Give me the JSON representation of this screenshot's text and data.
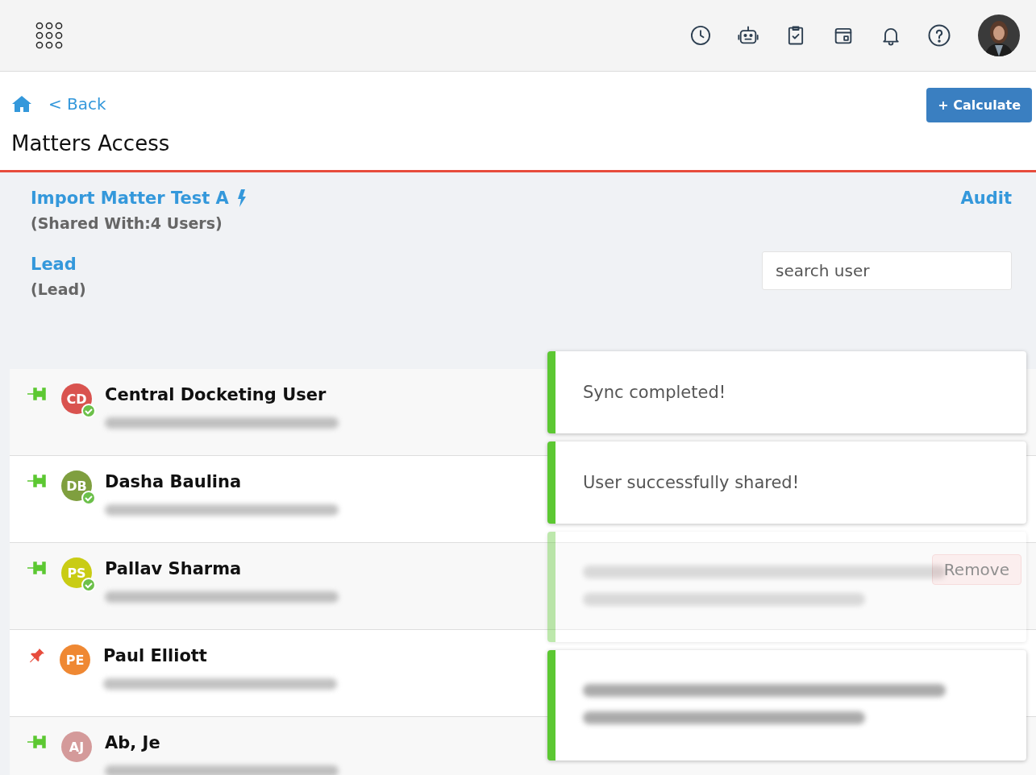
{
  "nav": {
    "back": "< Back"
  },
  "calculate_button": "+ Calculate",
  "page_title": "Matters Access",
  "matter": {
    "name": "Import Matter Test A",
    "shared": "(Shared With:4 Users)",
    "audit": "Audit"
  },
  "lead": {
    "label": "Lead",
    "value": "(Lead)"
  },
  "search": {
    "placeholder": "search user"
  },
  "users": [
    {
      "name": "Central Docketing User",
      "initials": "CD",
      "color": "#d9534f",
      "pinned": false,
      "verified": true
    },
    {
      "name": "Dasha Baulina",
      "initials": "DB",
      "color": "#7f9f3f",
      "pinned": false,
      "verified": true
    },
    {
      "name": "Pallav Sharma",
      "initials": "PS",
      "color": "#c9cc14",
      "pinned": false,
      "verified": true,
      "action": {
        "kind": "remove",
        "label": "Remove"
      }
    },
    {
      "name": "Paul Elliott",
      "initials": "PE",
      "color": "#ef8833",
      "pinned": true,
      "verified": false
    },
    {
      "name": "Ab, Je",
      "initials": "AJ",
      "color": "#d49a9a",
      "pinned": false,
      "verified": false
    }
  ],
  "toasts": [
    {
      "kind": "text",
      "message": "Sync completed!",
      "faded": false
    },
    {
      "kind": "text",
      "message": "User successfully shared!",
      "faded": false
    },
    {
      "kind": "blurred",
      "faded": true
    },
    {
      "kind": "blurred",
      "faded": false
    }
  ]
}
